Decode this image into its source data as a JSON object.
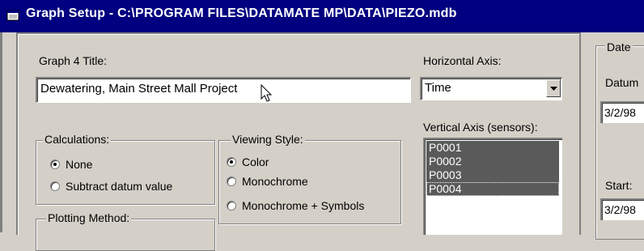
{
  "window": {
    "title": "Graph Setup - C:\\PROGRAM FILES\\DATAMATE MP\\DATA\\PIEZO.mdb"
  },
  "graph_title": {
    "label": "Graph 4 Title:",
    "value": "Dewatering, Main Street Mall Project"
  },
  "horizontal_axis": {
    "label": "Horizontal Axis:",
    "value": "Time"
  },
  "vertical_axis": {
    "label": "Vertical Axis (sensors):",
    "items": [
      "P0001",
      "P0002",
      "P0003",
      "P0004"
    ]
  },
  "calculations": {
    "label": "Calculations:",
    "options": [
      "None",
      "Subtract datum value"
    ],
    "selected": "None"
  },
  "viewing_style": {
    "label": "Viewing Style:",
    "options": [
      "Color",
      "Monochrome",
      "Monochrome + Symbols"
    ],
    "selected": "Color"
  },
  "plotting_method": {
    "label": "Plotting Method:"
  },
  "date_panel": {
    "label": "Date",
    "datum_label": "Datum",
    "datum_value": "3/2/98",
    "start_label": "Start:",
    "start_value": "3/2/98"
  },
  "colors": {
    "titlebar": "#000080",
    "face": "#d4d0c8",
    "list_selection": "#5a5a5a"
  }
}
